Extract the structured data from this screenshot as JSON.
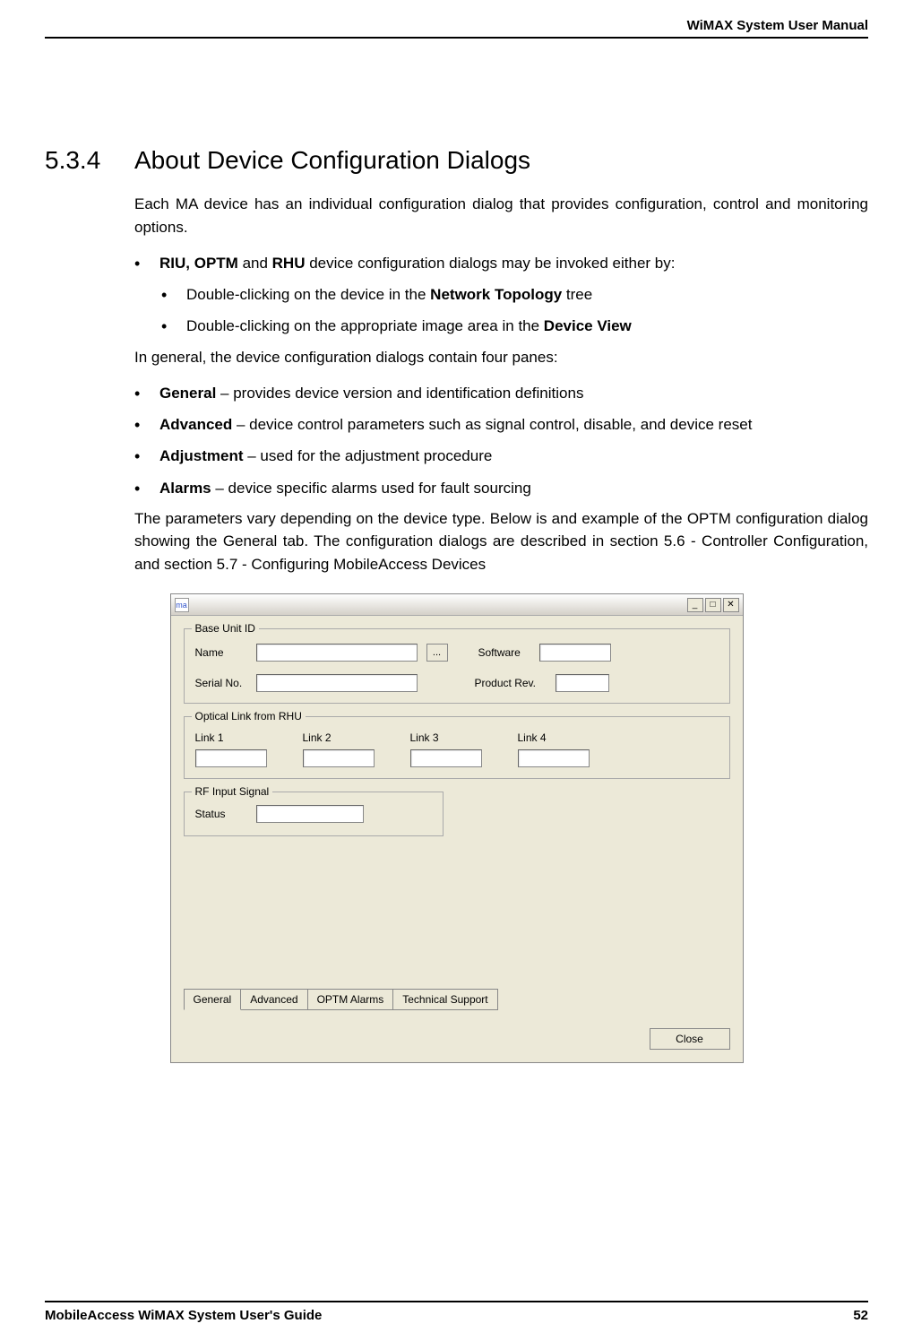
{
  "header": {
    "title": "WiMAX System User Manual"
  },
  "section": {
    "number": "5.3.4",
    "title": "About Device Configuration Dialogs"
  },
  "intro": "Each MA device has an individual configuration dialog that provides configuration, control and monitoring options.",
  "bullet1": {
    "b1": "RIU, OPTM",
    "mid": " and ",
    "b2": "RHU",
    "rest": " device configuration dialogs may be invoked either by:"
  },
  "sub1": {
    "pre": "Double-clicking on the device in the ",
    "bold": "Network Topology",
    "post": " tree"
  },
  "sub2": {
    "pre": "Double-clicking on the appropriate image area in the ",
    "bold": "Device View"
  },
  "panes_intro": "In general, the device configuration dialogs contain four panes:",
  "panes": {
    "p1b": "General",
    "p1t": " – provides device version and identification definitions",
    "p2b": "Advanced",
    "p2t": " – device control parameters such as signal control, disable, and device reset",
    "p3b": "Adjustment",
    "p3t": " – used for the adjustment procedure",
    "p4b": "Alarms",
    "p4t": " – device specific alarms used for fault sourcing"
  },
  "closing": "The parameters vary depending on the device type. Below is and example of the OPTM configuration dialog showing the General tab. The configuration dialogs are described in section 5.6 - Controller Configuration, and section 5.7 - Configuring MobileAccess Devices",
  "dialog": {
    "icon": "ma",
    "group1": {
      "title": "Base Unit ID",
      "name": "Name",
      "serial": "Serial No.",
      "software": "Software",
      "prodrev": "Product Rev.",
      "dots": "..."
    },
    "group2": {
      "title": "Optical Link from RHU",
      "l1": "Link 1",
      "l2": "Link 2",
      "l3": "Link 3",
      "l4": "Link 4"
    },
    "group3": {
      "title": "RF Input Signal",
      "status": "Status"
    },
    "tabs": {
      "t1": "General",
      "t2": "Advanced",
      "t3": "OPTM Alarms",
      "t4": "Technical Support"
    },
    "close": "Close"
  },
  "footer": {
    "left": "MobileAccess WiMAX System User's Guide",
    "right": "52"
  }
}
